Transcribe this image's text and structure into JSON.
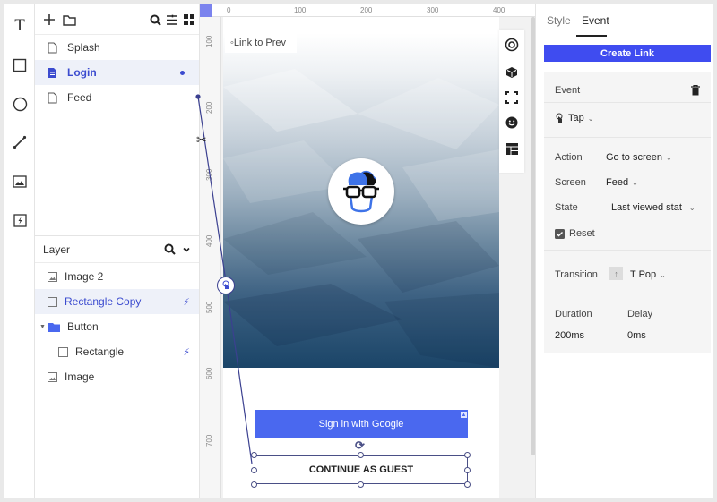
{
  "tools": [
    "text-tool",
    "rectangle-tool",
    "ellipse-tool",
    "line-tool",
    "image-tool",
    "hotspot-tool"
  ],
  "pages": {
    "items": [
      {
        "label": "Splash",
        "active": false
      },
      {
        "label": "Login",
        "active": true
      },
      {
        "label": "Feed",
        "active": false
      }
    ]
  },
  "layers": {
    "title": "Layer",
    "items": [
      {
        "label": "Image 2",
        "icon": "image-icon"
      },
      {
        "label": "Rectangle Copy",
        "icon": "rectangle-icon",
        "active": true,
        "linked": true
      },
      {
        "label": "Button",
        "icon": "folder-icon"
      },
      {
        "label": "Rectangle",
        "icon": "rectangle-icon",
        "linked": true
      },
      {
        "label": "Image",
        "icon": "image-icon"
      }
    ]
  },
  "ruler": {
    "top": [
      "0",
      "100",
      "200",
      "300",
      "400"
    ],
    "left": [
      "100",
      "200",
      "300",
      "400",
      "500",
      "600",
      "700"
    ]
  },
  "canvas": {
    "link_tag": "◦Link to Prev",
    "google_button": "Sign in with Google",
    "guest_button": "CONTINUE AS GUEST"
  },
  "props": {
    "tabs": [
      "Style",
      "Event"
    ],
    "active_tab": "Event",
    "create_link": "Create Link",
    "event_label": "Event",
    "trigger": "Tap",
    "action_label": "Action",
    "action_value": "Go to screen",
    "screen_label": "Screen",
    "screen_value": "Feed",
    "state_label": "State",
    "state_value": "Last viewed stat",
    "reset_label": "Reset",
    "reset_checked": true,
    "transition_label": "Transition",
    "transition_value": "T Pop",
    "duration_label": "Duration",
    "duration_value": "200ms",
    "delay_label": "Delay",
    "delay_value": "0ms"
  },
  "colors": {
    "accent": "#3f4cf0",
    "google_button": "#4a68ef",
    "selection": "#3b4bcf"
  }
}
